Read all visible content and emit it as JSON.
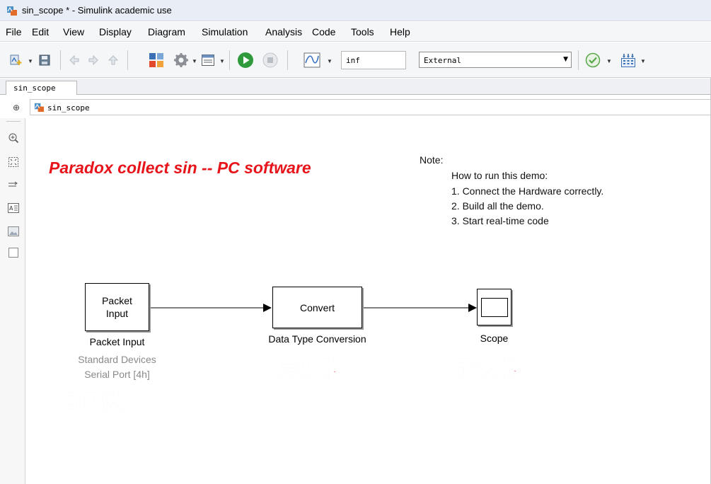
{
  "window": {
    "title": "sin_scope * - Simulink academic use"
  },
  "menu": {
    "items": [
      "File",
      "Edit",
      "View",
      "Display",
      "Diagram",
      "Simulation",
      "Analysis",
      "Code",
      "Tools",
      "Help"
    ]
  },
  "toolbar": {
    "stop_time": "inf",
    "simulation_mode": "External",
    "icons": [
      "new-model-icon",
      "save-icon",
      "back-icon",
      "forward-icon",
      "up-icon",
      "library-browser-icon",
      "model-config-icon",
      "model-explorer-icon",
      "run-icon",
      "stop-icon",
      "scope-signal-icon",
      "model-advisor-check-icon",
      "build-icon"
    ],
    "colors": {
      "run": "#2e9a3c",
      "check": "#58a84a"
    }
  },
  "tab": {
    "label": "sin_scope"
  },
  "breadcrumb": {
    "label": "sin_scope"
  },
  "palette": {
    "icons": [
      "zoom-icon",
      "fit-view-icon",
      "arrow-route-icon",
      "annotation-icon",
      "image-icon",
      "area-icon"
    ]
  },
  "canvas": {
    "headline": "Paradox collect sin  -- PC software",
    "headline_color": "#e8141b",
    "note": {
      "label": "Note:",
      "heading": "How to run this demo:",
      "steps": [
        "1.  Connect the Hardware correctly.",
        "2.  Build all the demo.",
        "3.  Start real-time code"
      ]
    },
    "blocks": {
      "packet_input": {
        "text_line1": "Packet",
        "text_line2": "Input",
        "name": "Packet Input",
        "sub1": "Standard Devices",
        "sub2": "Serial Port [4h]",
        "annotation": "串口设置"
      },
      "convert": {
        "text": "Convert",
        "name": "Data Type Conversion",
        "annotation": "转换器"
      },
      "scope": {
        "name": "Scope",
        "annotation": "示波器"
      }
    },
    "annotation_color": "#f02030"
  }
}
